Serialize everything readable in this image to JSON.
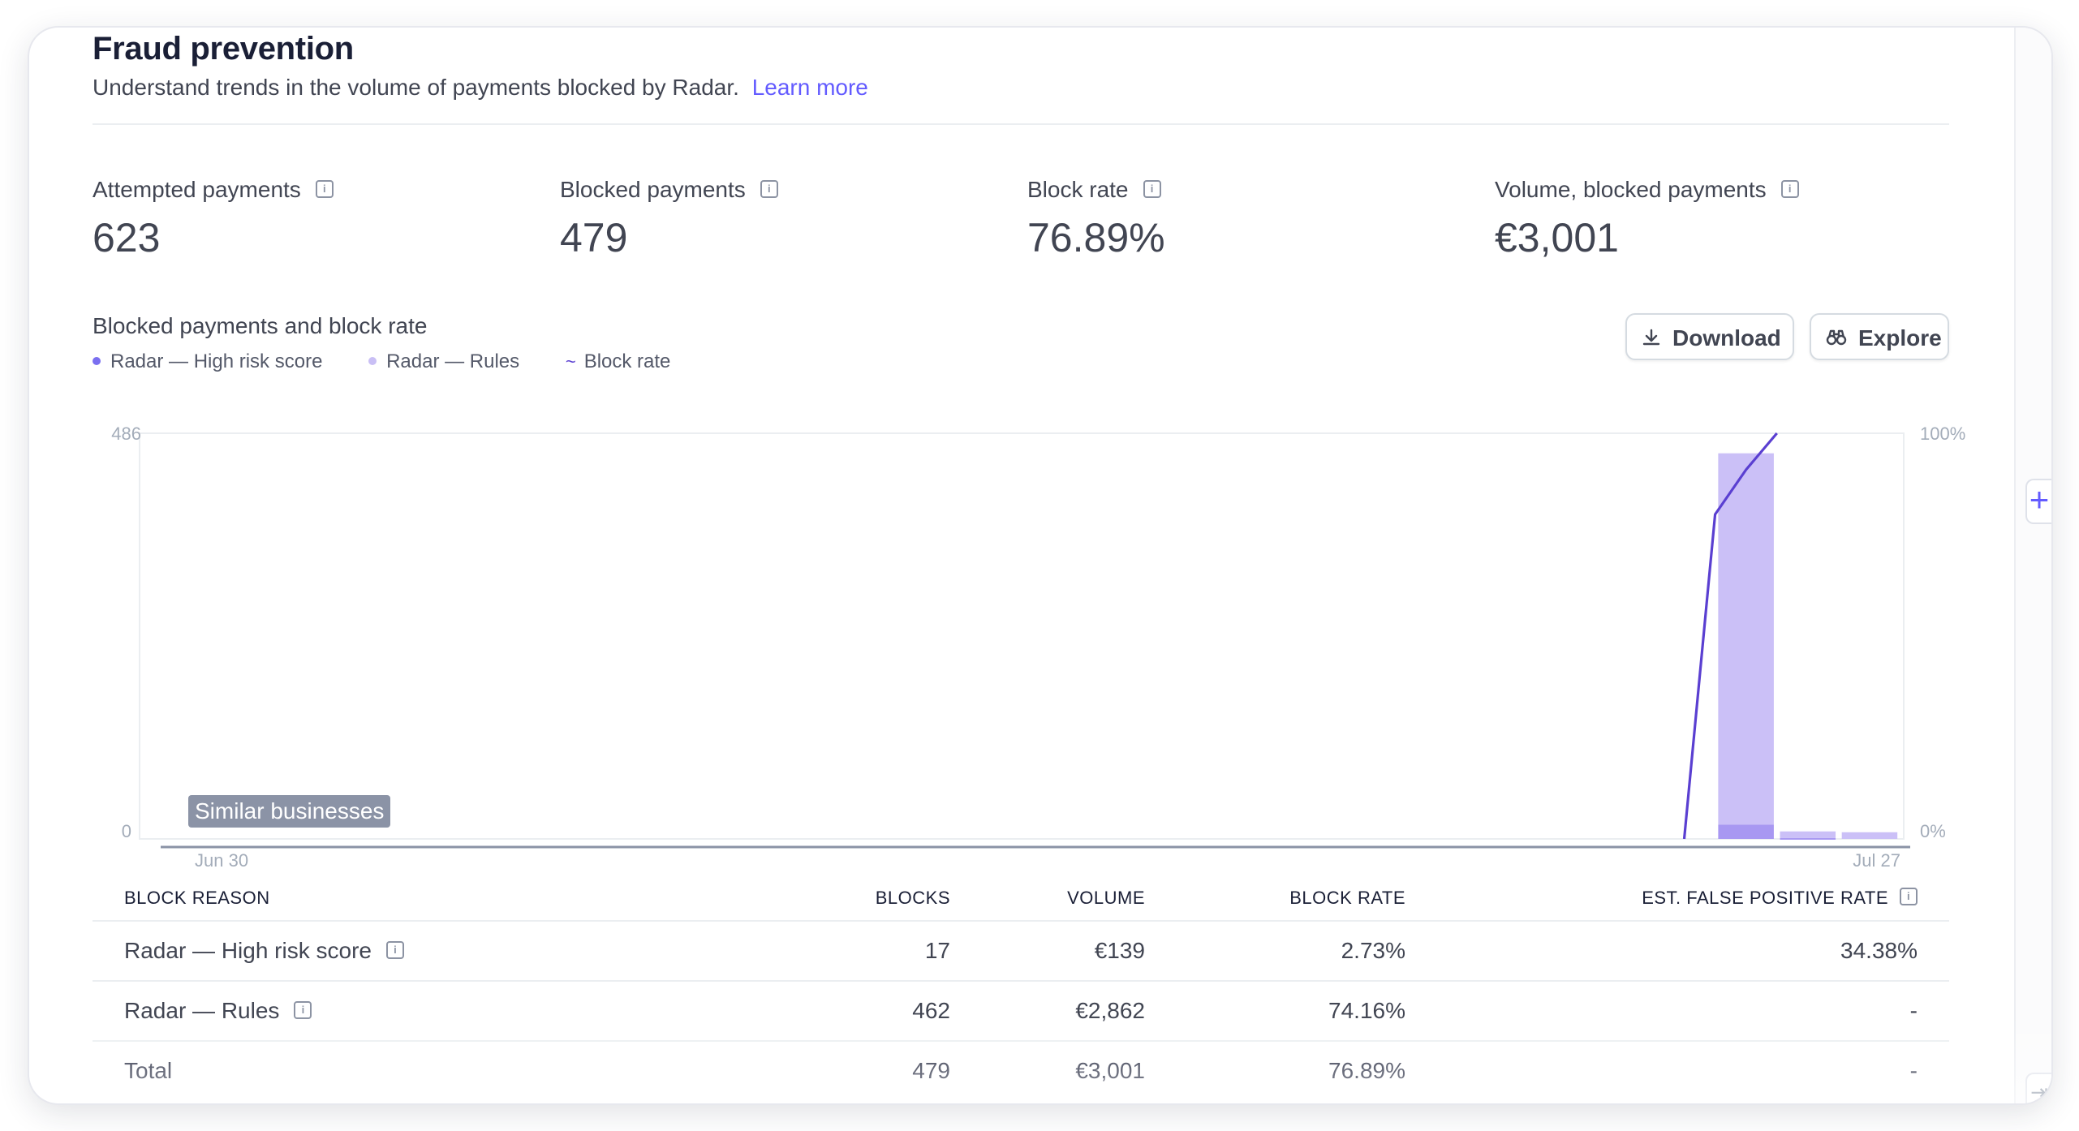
{
  "header": {
    "title": "Fraud prevention",
    "subtitle": "Understand trends in the volume of payments blocked by Radar.",
    "learn_more": "Learn more"
  },
  "metrics": [
    {
      "label": "Attempted payments",
      "value": "623"
    },
    {
      "label": "Blocked payments",
      "value": "479"
    },
    {
      "label": "Block rate",
      "value": "76.89%"
    },
    {
      "label": "Volume, blocked payments",
      "value": "€3,001"
    }
  ],
  "chart_section": {
    "title": "Blocked payments and block rate",
    "legend": [
      {
        "label": "Radar — High risk score",
        "color": "#7a6ff0",
        "marker": "dot"
      },
      {
        "label": "Radar — Rules",
        "color": "#c9bff5",
        "marker": "dot"
      },
      {
        "label": "Block rate",
        "color": "#5a3fd1",
        "marker": "line"
      }
    ],
    "buttons": {
      "download": "Download",
      "explore": "Explore"
    },
    "overlay_tag": "Similar businesses"
  },
  "chart_data": {
    "type": "bar",
    "x_start_label": "Jun 30",
    "x_end_label": "Jul 27",
    "y_left_ticks": [
      "486",
      "0"
    ],
    "y_right_ticks": [
      "100%",
      "0%"
    ],
    "ylim_left": [
      0,
      486
    ],
    "ylim_right": [
      0,
      100
    ],
    "n_days": 28,
    "bar_indices": [
      25,
      26,
      27
    ],
    "series": [
      {
        "name": "Radar — High risk score",
        "color": "#a898f2",
        "values": [
          17,
          1,
          0
        ]
      },
      {
        "name": "Radar — Rules",
        "color": "#cbc0f7",
        "values": [
          445,
          8,
          8
        ]
      }
    ],
    "line": {
      "name": "Block rate",
      "color": "#5a3fd1",
      "points": [
        [
          24.5,
          0
        ],
        [
          25.0,
          80
        ],
        [
          25.5,
          91
        ],
        [
          26.0,
          100
        ]
      ]
    },
    "baseline_color": "#8b93a6"
  },
  "table": {
    "headers": [
      "BLOCK REASON",
      "BLOCKS",
      "VOLUME",
      "BLOCK RATE",
      "EST. FALSE POSITIVE RATE"
    ],
    "rows": [
      {
        "reason": "Radar — High risk score",
        "blocks": "17",
        "volume": "€139",
        "rate": "2.73%",
        "fpr": "34.38%"
      },
      {
        "reason": "Radar — Rules",
        "blocks": "462",
        "volume": "€2,862",
        "rate": "74.16%",
        "fpr": "-"
      }
    ],
    "total": {
      "reason": "Total",
      "blocks": "479",
      "volume": "€3,001",
      "rate": "76.89%",
      "fpr": "-"
    }
  },
  "icons": {
    "info": "info-icon",
    "download": "download-icon",
    "explore": "binoculars-icon",
    "add": "plus-icon",
    "collapse": "panel-collapse-icon"
  }
}
